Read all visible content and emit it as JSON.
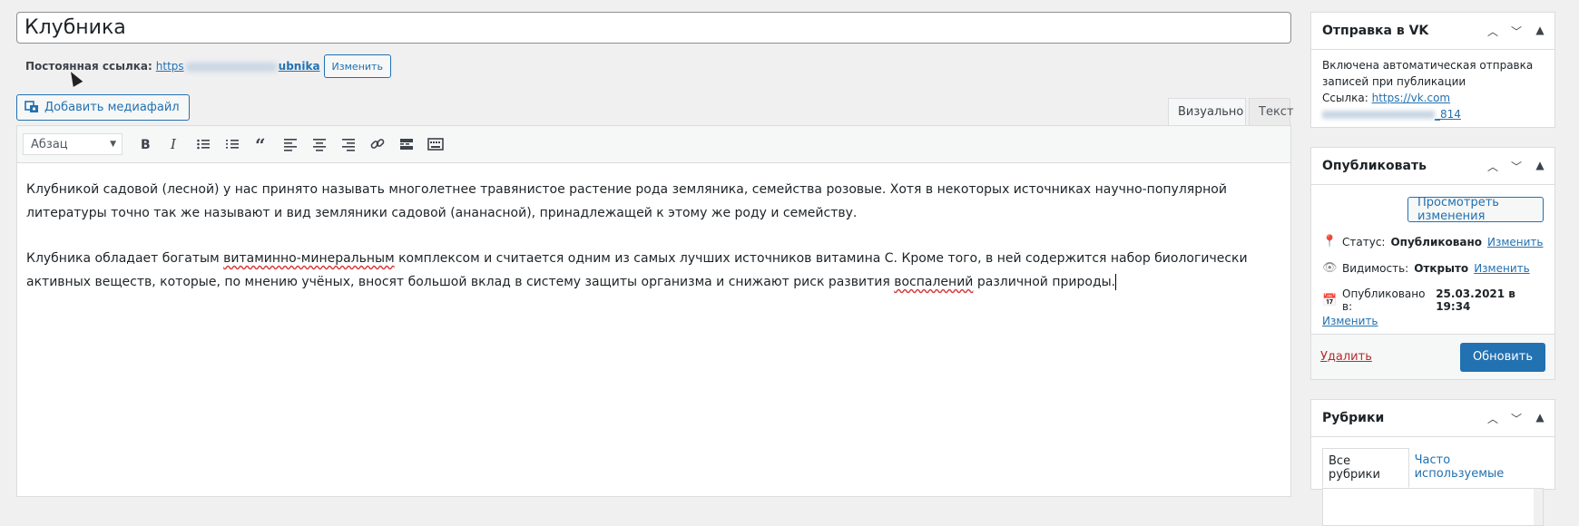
{
  "post": {
    "title": "Клубника",
    "permalink_label": "Постоянная ссылка:",
    "permalink_start": "https",
    "permalink_slug_end": "ubnika",
    "permalink_edit": "Изменить"
  },
  "editor": {
    "add_media": "Добавить медиафайл",
    "tab_visual": "Визуально",
    "tab_text": "Текст",
    "format": "Абзац",
    "p1": "Клубникой садовой (лесной) у нас принято называть многолетнее травянистое растение рода земляника, семейства розовые. Хотя в некоторых источниках научно-популярной литературы точно так же называют и вид земляники садовой (ананасной), принадлежащей к этому же роду и семейству.",
    "p2_a": "Клубника обладает богатым ",
    "p2_mark1": "витаминно-минеральным",
    "p2_b": " комплексом и считается одним из самых лучших источников витамина С. Кроме того, в ней содержится набор биологически активных веществ, которые, по мнению учёных, вносят большой вклад в систему защиты организма и снижают риск развития ",
    "p2_mark2": "воспалений",
    "p2_c": " различной природы."
  },
  "vk": {
    "title": "Отправка в VK",
    "line1": "Включена автоматическая отправка",
    "line2": "записей при публикации",
    "link_label": "Ссылка:",
    "link_start": "https://vk.com",
    "link_end": "_814"
  },
  "publish": {
    "title": "Опубликовать",
    "preview": "Просмотреть изменения",
    "status_label": "Статус:",
    "status_value": "Опубликовано",
    "visibility_label": "Видимость:",
    "visibility_value": "Открыто",
    "published_label": "Опубликовано в:",
    "published_value": "25.03.2021 в 19:34",
    "edit": "Изменить",
    "delete": "Удалить",
    "update": "Обновить"
  },
  "categories": {
    "title": "Рубрики",
    "tab_all": "Все рубрики",
    "tab_popular": "Часто используемые"
  },
  "icons": [
    "chevron-up-icon",
    "chevron-down-icon",
    "triangle-up-icon",
    "bold-icon",
    "italic-icon",
    "bullet-list-icon",
    "numbered-list-icon",
    "quote-icon",
    "align-left-icon",
    "align-center-icon",
    "align-right-icon",
    "link-icon",
    "read-more-icon",
    "keyboard-icon",
    "pin-icon",
    "eye-icon",
    "calendar-icon",
    "media-icon"
  ]
}
